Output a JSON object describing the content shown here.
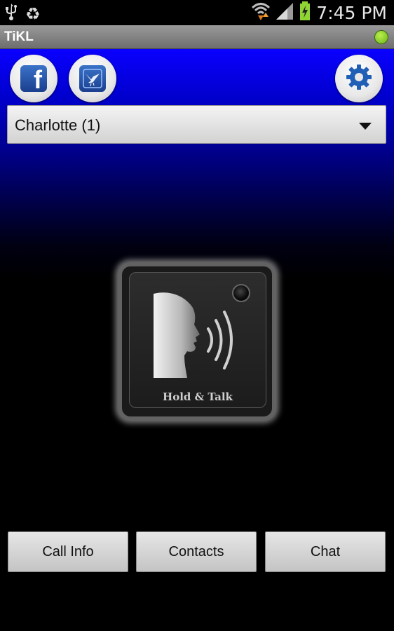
{
  "status_bar": {
    "time": "7:45 PM",
    "icons": [
      "usb-icon",
      "recycle-icon",
      "wifi-icon",
      "signal-icon",
      "battery-charging-icon"
    ]
  },
  "app": {
    "title": "TiKL",
    "status_color": "#8fd433"
  },
  "share": {
    "facebook_letter": "f",
    "icons": [
      "facebook-icon",
      "bird-icon",
      "gear-icon"
    ]
  },
  "contact_select": {
    "selected": "Charlotte (1)"
  },
  "talk": {
    "label": "Hold & Talk"
  },
  "bottom_buttons": {
    "call_info": "Call Info",
    "contacts": "Contacts",
    "chat": "Chat"
  },
  "colors": {
    "header_blue": "#0a00ff",
    "background": "#000000"
  }
}
